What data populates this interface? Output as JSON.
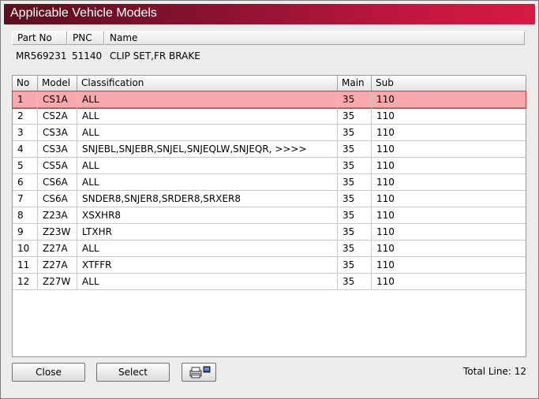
{
  "window": {
    "title": "Applicable Vehicle Models"
  },
  "part_info": {
    "headers": [
      "Part No",
      "PNC",
      "Name"
    ],
    "values": [
      "MR569231",
      "51140",
      "CLIP SET,FR BRAKE"
    ]
  },
  "table": {
    "columns": [
      "No",
      "Model",
      "Classification",
      "Main",
      "Sub"
    ],
    "rows": [
      [
        "1",
        "CS1A",
        "ALL",
        "35",
        "110"
      ],
      [
        "2",
        "CS2A",
        "ALL",
        "35",
        "110"
      ],
      [
        "3",
        "CS3A",
        "ALL",
        "35",
        "110"
      ],
      [
        "4",
        "CS3A",
        "SNJEBL,SNJEBR,SNJEL,SNJEQLW,SNJEQR,  >>>>",
        "35",
        "110"
      ],
      [
        "5",
        "CS5A",
        "ALL",
        "35",
        "110"
      ],
      [
        "6",
        "CS6A",
        "ALL",
        "35",
        "110"
      ],
      [
        "7",
        "CS6A",
        "SNDER8,SNJER8,SRDER8,SRXER8",
        "35",
        "110"
      ],
      [
        "8",
        "Z23A",
        "XSXHR8",
        "35",
        "110"
      ],
      [
        "9",
        "Z23W",
        "LTXHR",
        "35",
        "110"
      ],
      [
        "10",
        "Z27A",
        "ALL",
        "35",
        "110"
      ],
      [
        "11",
        "Z27A",
        "XTFFR",
        "35",
        "110"
      ],
      [
        "12",
        "Z27W",
        "ALL",
        "35",
        "110"
      ]
    ],
    "selected_row": 0
  },
  "footer": {
    "close_label": "Close",
    "select_label": "Select",
    "print_icon": "printer-icon",
    "total_line": "Total Line: 12"
  }
}
